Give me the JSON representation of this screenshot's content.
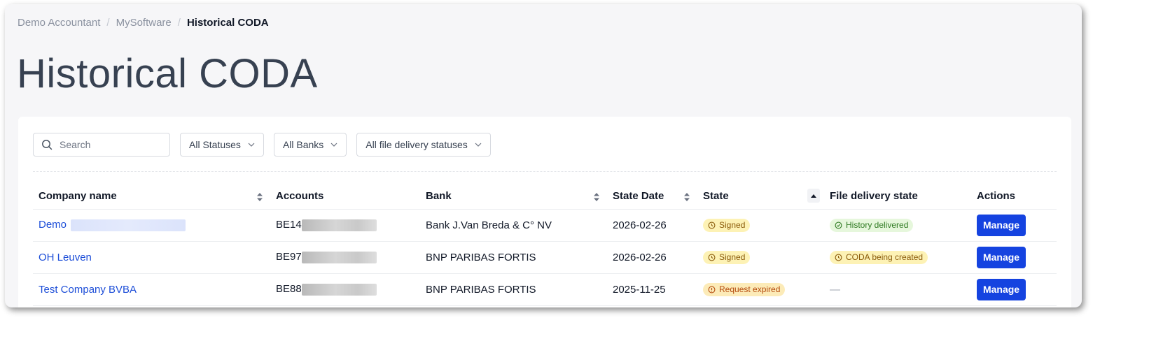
{
  "breadcrumb": [
    "Demo Accountant",
    "MySoftware",
    "Historical CODA"
  ],
  "page_title": "Historical CODA",
  "filters": {
    "search_placeholder": "Search",
    "status": "All Statuses",
    "bank": "All Banks",
    "delivery": "All file delivery statuses"
  },
  "table": {
    "headers": {
      "company": "Company name",
      "accounts": "Accounts",
      "bank": "Bank",
      "state_date": "State Date",
      "state": "State",
      "file_delivery": "File delivery state",
      "actions": "Actions"
    },
    "rows": [
      {
        "company": "Demo",
        "account": "BE14",
        "bank": "Bank J.Van Breda & C° NV",
        "state_date": "2026-02-26",
        "state": "Signed",
        "state_icon": "clock-icon",
        "delivery": "History delivered",
        "delivery_icon": "check-circle-icon",
        "action": "Manage"
      },
      {
        "company": "OH Leuven",
        "account": "BE97",
        "bank": "BNP PARIBAS FORTIS",
        "state_date": "2026-02-26",
        "state": "Signed",
        "state_icon": "clock-icon",
        "delivery": "CODA being created",
        "delivery_icon": "clock-icon",
        "action": "Manage"
      },
      {
        "company": "Test Company BVBA",
        "account": "BE88",
        "bank": "BNP PARIBAS FORTIS",
        "state_date": "2025-11-25",
        "state": "Request expired",
        "state_icon": "alert-circle-icon",
        "delivery": "—",
        "delivery_icon": "",
        "action": "Manage"
      }
    ]
  },
  "colors": {
    "primary_button": "#1543e0",
    "link": "#1d4ed8",
    "badge_yellow_bg": "#fdf2b5",
    "badge_green_bg": "#e6f7dc",
    "badge_orange_bg": "#fcebb8"
  }
}
